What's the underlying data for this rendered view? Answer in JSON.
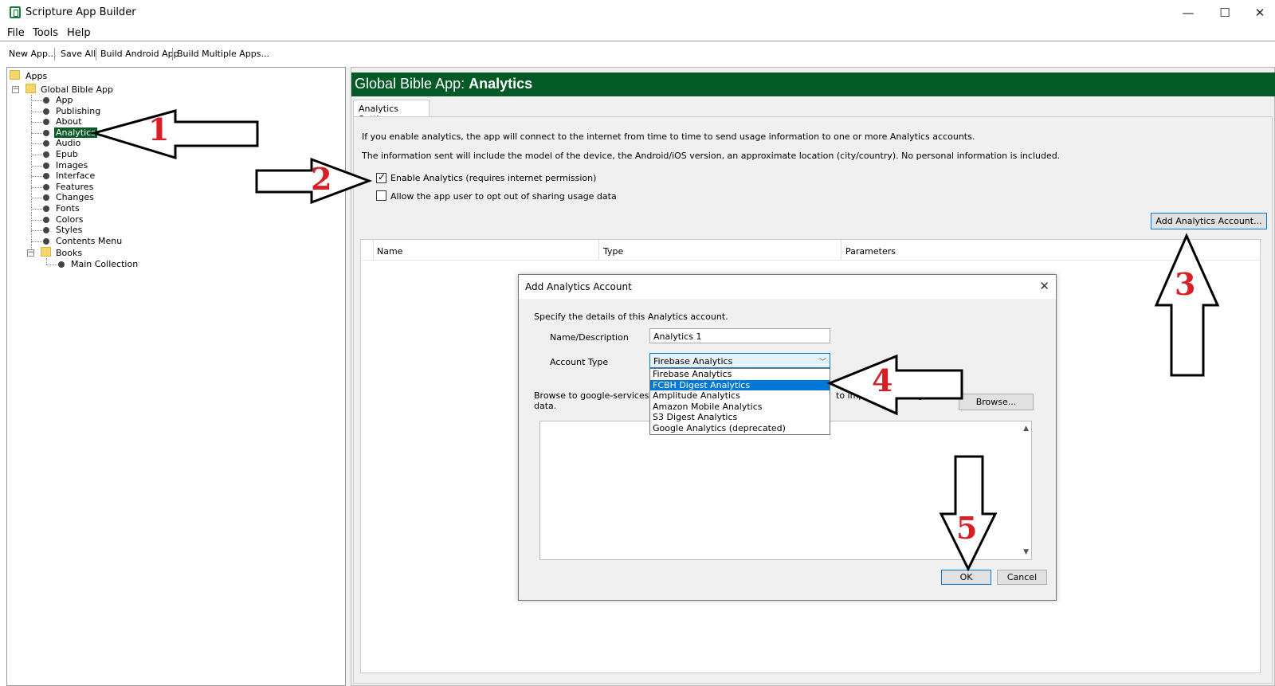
{
  "window": {
    "title": "Scripture App Builder",
    "minimize": "—",
    "maximize": "☐",
    "close": "✕"
  },
  "menu": [
    "File",
    "Tools",
    "Help"
  ],
  "toolbar": [
    "New App...",
    "Save All",
    "Build Android App",
    "Build Multiple Apps..."
  ],
  "tree": {
    "root": "Apps",
    "app": "Global Bible App",
    "items": [
      "App",
      "Publishing",
      "About",
      "Analytics",
      "Audio",
      "Epub",
      "Images",
      "Interface",
      "Features",
      "Changes",
      "Fonts",
      "Colors",
      "Styles",
      "Contents Menu"
    ],
    "selected_index": 3,
    "books": "Books",
    "collection": "Main Collection"
  },
  "header": {
    "prefix": "Global Bible App: ",
    "section": "Analytics"
  },
  "tab": "Analytics Settings",
  "info": [
    "If you enable analytics, the app will connect to the internet from time to time to send usage information to one or more Analytics accounts.",
    "The information sent will include the model of the device, the Android/iOS version, an approximate location (city/country). No personal information is included."
  ],
  "checkboxes": [
    {
      "label": "Enable Analytics (requires internet permission)",
      "checked": true
    },
    {
      "label": "Allow the app user to opt out of sharing usage data",
      "checked": false
    }
  ],
  "add_button": "Add Analytics Account...",
  "grid_columns": [
    "Name",
    "Type",
    "Parameters"
  ],
  "dialog": {
    "title": "Add Analytics Account",
    "close": "✕",
    "intro": "Specify the details of this Analytics account.",
    "name_label": "Name/Description",
    "name_value": "Analytics 1",
    "type_label": "Account Type",
    "type_value": "Firebase Analytics",
    "options": [
      "Firebase Analytics",
      "FCBH Digest Analytics",
      "Amplitude Analytics",
      "Amazon Mobile Analytics",
      "S3 Digest Analytics",
      "Google Analytics (deprecated)"
    ],
    "highlighted_index": 1,
    "browse_text_1": "Browse to google-services.json",
    "browse_text_2": "to import the configuration",
    "browse_text_3": "data.",
    "browse_button": "Browse...",
    "ok": "OK",
    "cancel": "Cancel"
  },
  "annotations": [
    "1",
    "2",
    "3",
    "4",
    "5"
  ],
  "colors": {
    "header_bg": "#035a27",
    "selected_bg": "#0b5b2a",
    "highlight": "#0078d7",
    "annotation": "#d81f26"
  }
}
